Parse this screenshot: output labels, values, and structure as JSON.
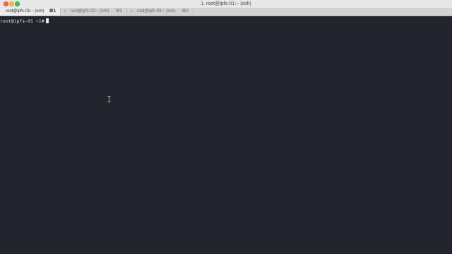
{
  "window": {
    "title": "1. root@ipfs-01:~ (ssh)"
  },
  "tabs": [
    {
      "label": "root@ipfs-01:~ (ssh)",
      "shortcut": "⌘1",
      "active": true
    },
    {
      "label": "root@ipfs-02:~ (ssh)",
      "shortcut": "⌘2",
      "active": false
    },
    {
      "label": "root@ipfs-03:~ (ssh)",
      "shortcut": "⌘3",
      "active": false
    }
  ],
  "terminal": {
    "prompt": "root@ipfs-01 ~]#"
  },
  "colors": {
    "terminal_background": "#23252e",
    "terminal_text": "#e8e8e8",
    "titlebar": "#e7e7e7",
    "close": "#fc605c",
    "minimize": "#fdbc40",
    "zoom": "#34c84a"
  },
  "icons": {
    "tab_close": "close-icon",
    "mouse_cursor": "text-cursor-icon"
  }
}
